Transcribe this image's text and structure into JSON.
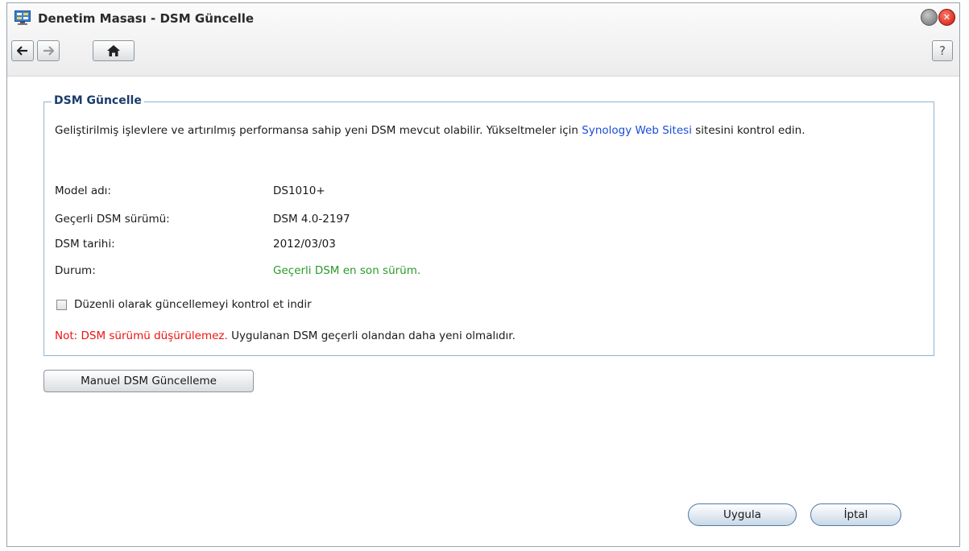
{
  "window": {
    "title": "Denetim Masası - DSM Güncelle",
    "icon": "control-panel-icon"
  },
  "toolbar": {
    "back_icon": "arrow-left-icon",
    "forward_icon": "arrow-right-icon",
    "home_icon": "home-icon",
    "help_label": "?"
  },
  "section": {
    "legend": "DSM Güncelle",
    "intro_before": "Geliştirilmiş işlevlere ve artırılmış performansa sahip yeni DSM mevcut olabilir. Yükseltmeler için ",
    "intro_link": "Synology Web Sitesi",
    "intro_after": " sitesini kontrol edin.",
    "rows": [
      {
        "label": "Model adı:",
        "value": "DS1010+"
      },
      {
        "label": "Geçerli DSM sürümü:",
        "value": "DSM 4.0-2197"
      },
      {
        "label": "DSM tarihi:",
        "value": "2012/03/03"
      },
      {
        "label": "Durum:",
        "value": "Geçerli DSM en son sürüm."
      }
    ],
    "checkbox_label": "Düzenli olarak güncellemeyi kontrol et indir",
    "checkbox_checked": false,
    "note_red": "Not: DSM sürümü düşürülemez.",
    "note_rest": " Uygulanan DSM geçerli olandan daha yeni olmalıdır."
  },
  "buttons": {
    "manual": "Manuel DSM Güncelleme",
    "apply": "Uygula",
    "cancel": "İptal"
  },
  "colors": {
    "status_ok": "#2a9a2a",
    "note_warning": "#ee1111",
    "link": "#1a4cd8",
    "legend": "#1b3d6e"
  }
}
